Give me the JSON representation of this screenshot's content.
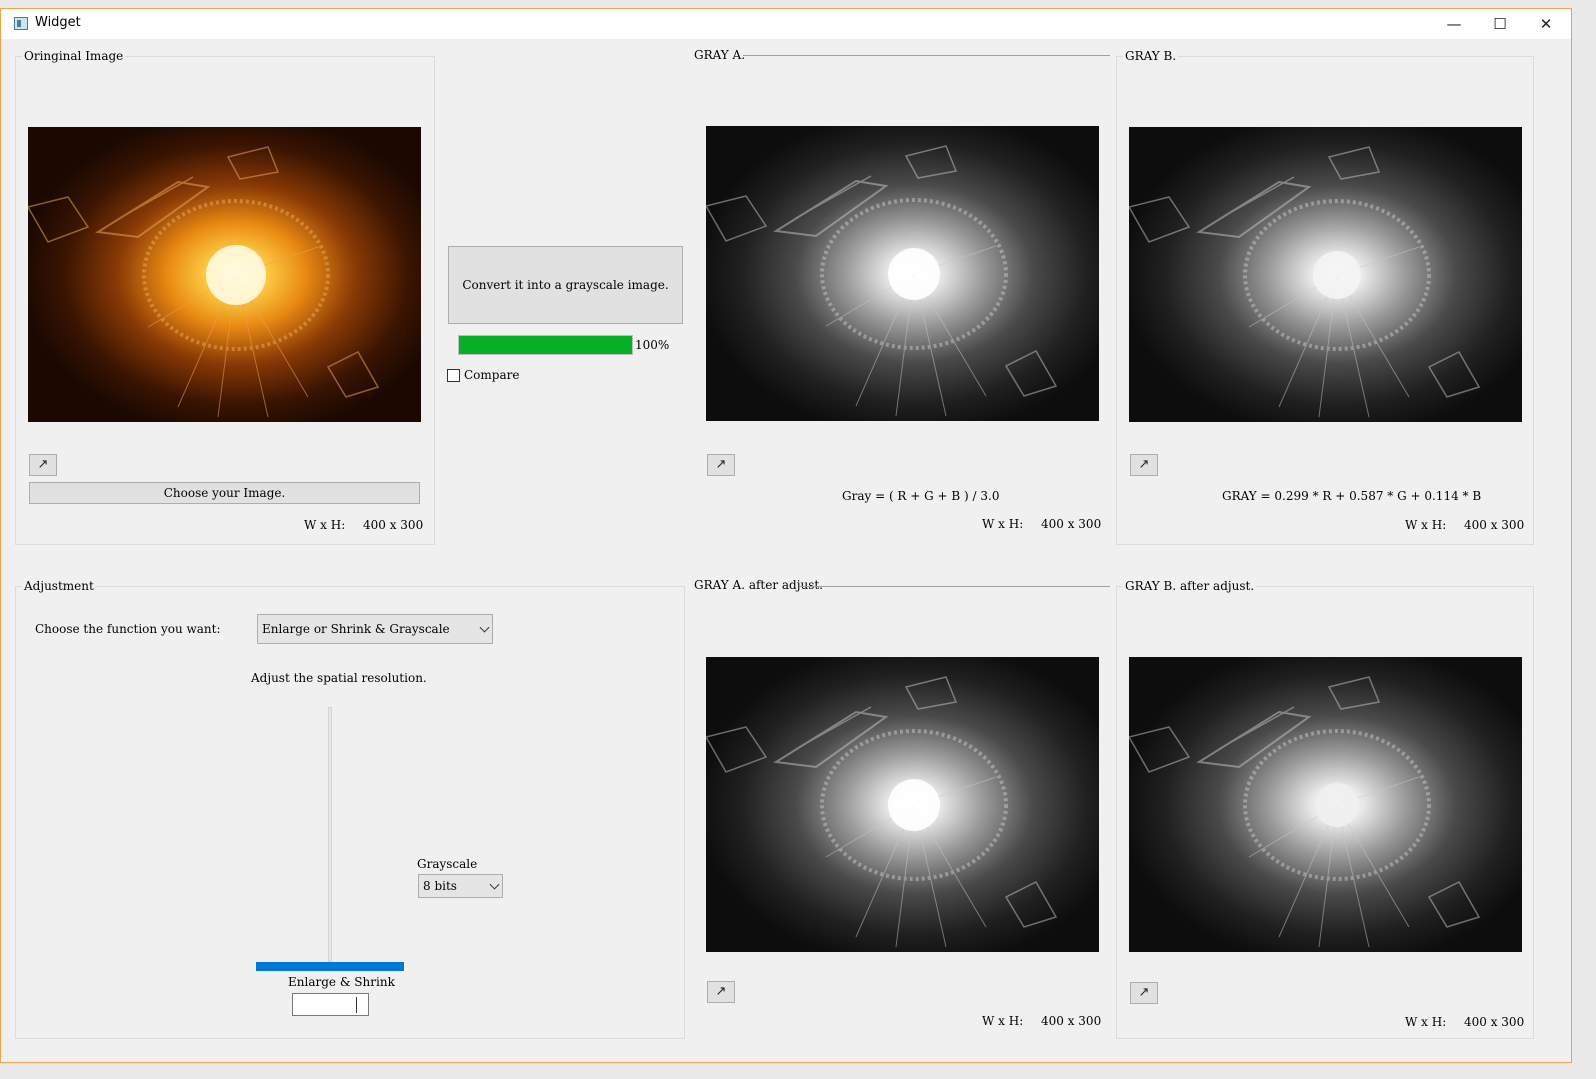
{
  "window": {
    "title": "Widget",
    "minimize_glyph": "—",
    "maximize_glyph": "☐",
    "close_glyph": "✕"
  },
  "original": {
    "group_title": "Oringinal Image",
    "expand_icon": "↗",
    "choose_label": "Choose your Image.",
    "size_label": "W x H:",
    "size_value": "400 x 300"
  },
  "convert": {
    "button_label": "Convert it into a grayscale image.",
    "progress_value": 100,
    "progress_text": "100%",
    "compare_label": "Compare",
    "compare_checked": false
  },
  "gray_a": {
    "group_title": "GRAY A.",
    "expand_icon": "↗",
    "formula": "Gray = ( R + G + B ) / 3.0",
    "size_label": "W x H:",
    "size_value": "400 x 300"
  },
  "gray_b": {
    "group_title": "GRAY B.",
    "expand_icon": "↗",
    "formula": "GRAY = 0.299 * R + 0.587 * G + 0.114 * B",
    "size_label": "W x H:",
    "size_value": "400 x 300"
  },
  "adjustment": {
    "group_title": "Adjustment",
    "function_label": "Choose the function you want:",
    "function_selected": "Enlarge or Shrink & Grayscale",
    "resolution_label": "Adjust the spatial resolution.",
    "grayscale_label": "Grayscale",
    "grayscale_selected": "8 bits",
    "enlarge_label": "Enlarge & Shrink",
    "spin_value": ""
  },
  "gray_a_adj": {
    "group_title": "GRAY A. after adjust.",
    "expand_icon": "↗",
    "size_label": "W x H:",
    "size_value": "400 x 300"
  },
  "gray_b_adj": {
    "group_title": "GRAY B. after adjust.",
    "expand_icon": "↗",
    "size_label": "W x H:",
    "size_value": "400 x 300"
  },
  "colors": {
    "accent_blue": "#0078d7",
    "progress_green": "#06b025",
    "window_border": "#f0a24a"
  }
}
